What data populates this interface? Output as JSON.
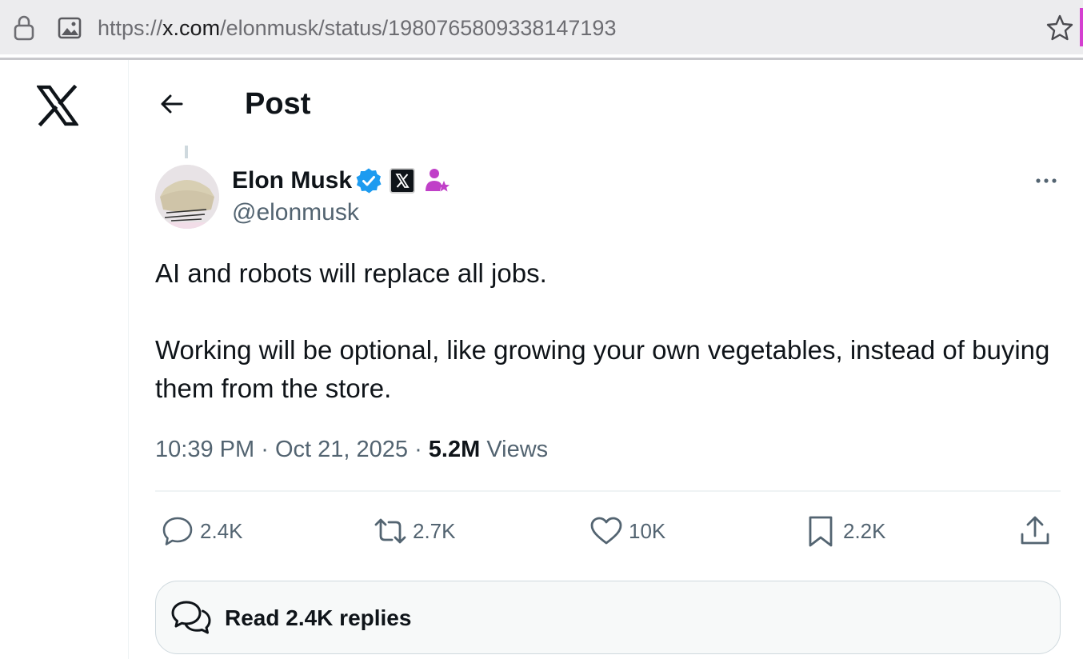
{
  "browser": {
    "url_scheme": "https://",
    "url_host": "x.com",
    "url_path": "/elonmusk/status/1980765809338147193"
  },
  "header": {
    "title": "Post"
  },
  "post": {
    "author_name": "Elon Musk",
    "handle": "@elonmusk",
    "paragraphs": [
      "AI and robots will replace all jobs.",
      "Working will be optional, like growing your own vegetables, instead of buying them from the store."
    ],
    "time": "10:39 PM",
    "date": "Oct 21, 2025",
    "separator": "·",
    "views_count": "5.2M",
    "views_label": "Views"
  },
  "actions": {
    "replies": "2.4K",
    "reposts": "2.7K",
    "likes": "10K",
    "bookmarks": "2.2K"
  },
  "read_replies_label": "Read 2.4K replies",
  "icons": {
    "lock": "lock-icon",
    "page": "page-icon",
    "bookmark_star": "star-icon",
    "logo": "x-logo-icon",
    "back": "back-arrow-icon",
    "verified": "verified-badge-icon",
    "affiliate": "x-affiliate-badge-icon",
    "person_star": "person-star-icon",
    "more": "more-icon",
    "reply": "reply-icon",
    "repost": "repost-icon",
    "like": "heart-icon",
    "bookmark": "bookmark-icon",
    "share": "share-icon",
    "replies": "replies-icon"
  },
  "colors": {
    "verified": "#1d9bf0",
    "person_star": "#c040c8",
    "text_primary": "#0f1419",
    "text_secondary": "#536471"
  }
}
